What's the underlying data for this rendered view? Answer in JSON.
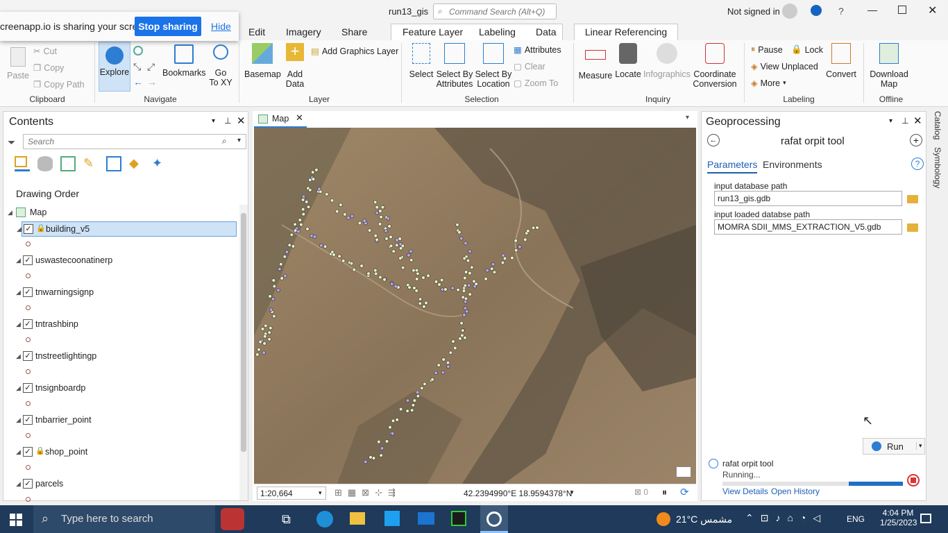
{
  "window": {
    "title": "run13_gis",
    "command_search_placeholder": "Command Search (Alt+Q)",
    "signed_in": "Not signed in",
    "help": "?"
  },
  "share_bar": {
    "message": "creenapp.io is sharing your screen.",
    "stop": "Stop sharing",
    "hide": "Hide"
  },
  "ribbon_tabs": [
    {
      "label": "Edit"
    },
    {
      "label": "Imagery"
    },
    {
      "label": "Share"
    },
    {
      "label": "Feature Layer"
    },
    {
      "label": "Labeling"
    },
    {
      "label": "Data"
    },
    {
      "label": "Linear Referencing"
    }
  ],
  "ribbon": {
    "clipboard": {
      "group": "Clipboard",
      "paste": "Paste",
      "cut": "Cut",
      "copy": "Copy",
      "copy_path": "Copy Path"
    },
    "navigate": {
      "group": "Navigate",
      "explore": "Explore",
      "bookmarks": "Bookmarks",
      "go_to_xy_1": "Go",
      "go_to_xy_2": "To XY"
    },
    "layer": {
      "group": "Layer",
      "basemap": "Basemap",
      "add_data_1": "Add",
      "add_data_2": "Data",
      "add_graphics": "Add Graphics Layer"
    },
    "selection": {
      "group": "Selection",
      "select": "Select",
      "select_by_attr_1": "Select By",
      "select_by_attr_2": "Attributes",
      "select_by_loc_1": "Select By",
      "select_by_loc_2": "Location",
      "attributes": "Attributes",
      "clear": "Clear",
      "zoom_to": "Zoom To"
    },
    "inquiry": {
      "group": "Inquiry",
      "measure": "Measure",
      "locate": "Locate",
      "infographics": "Infographics",
      "coord_1": "Coordinate",
      "coord_2": "Conversion"
    },
    "labeling": {
      "group": "Labeling",
      "pause": "Pause",
      "lock": "Lock",
      "view_unplaced": "View Unplaced",
      "more": "More",
      "convert": "Convert"
    },
    "offline": {
      "group": "Offline",
      "download_1": "Download",
      "download_2": "Map"
    }
  },
  "contents": {
    "title": "Contents",
    "search_placeholder": "Search",
    "drawing_order": "Drawing Order",
    "map_label": "Map",
    "layers": [
      {
        "name": "building_v5",
        "locked": true,
        "selected": true
      },
      {
        "name": "uswastecoonatinerp",
        "locked": false,
        "selected": false
      },
      {
        "name": "tnwarningsignp",
        "locked": false,
        "selected": false
      },
      {
        "name": "tntrashbinp",
        "locked": false,
        "selected": false
      },
      {
        "name": "tnstreetlightingp",
        "locked": false,
        "selected": false
      },
      {
        "name": "tnsignboardp",
        "locked": false,
        "selected": false
      },
      {
        "name": "tnbarrier_point",
        "locked": false,
        "selected": false
      },
      {
        "name": "shop_point",
        "locked": true,
        "selected": false
      },
      {
        "name": "parcels",
        "locked": false,
        "selected": false
      }
    ]
  },
  "map": {
    "tab": "Map",
    "scale": "1:20,664",
    "coords": "42.2394990°E 18.9594378°N",
    "selected_count": "0"
  },
  "geoprocessing": {
    "title": "Geoprocessing",
    "tool_name": "rafat orpit tool",
    "tab_parameters": "Parameters",
    "tab_environments": "Environments",
    "param1_label": "input database path",
    "param1_value": "run13_gis.gdb",
    "param2_label": "input loaded databse path",
    "param2_value": "MOMRA SDII_MMS_EXTRACTION_V5.gdb",
    "run": "Run",
    "status_tool": "rafat orpit tool",
    "status": "Running...",
    "progress": 0.9,
    "view_details": "View Details",
    "open_history": "Open History"
  },
  "side_tabs": [
    "Catalog",
    "Symbology"
  ],
  "taskbar": {
    "search_placeholder": "Type here to search",
    "weather": "21°C  مشمس",
    "lang": "ENG",
    "time": "4:04 PM",
    "date": "1/25/2023"
  },
  "colors": {
    "accent": "#1a73e8",
    "selected_row": "#cfe3f7",
    "progress": "#1f6fc5"
  }
}
